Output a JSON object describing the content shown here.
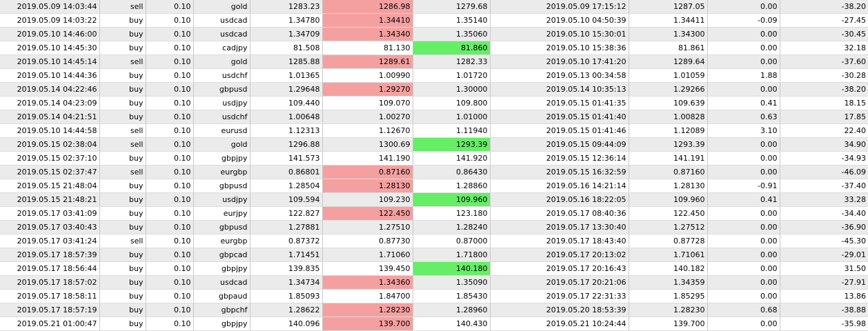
{
  "colors": {
    "row_shade": "#ebebeb",
    "row_plain": "#ffffff",
    "stop_loss_hit": "#f5a0a0",
    "take_profit_hit": "#66ee66",
    "grid_line": "#c8c8c8"
  },
  "columns": [
    "open_time",
    "type",
    "size",
    "item",
    "price",
    "stop_loss",
    "take_profit",
    "close_time",
    "close_price",
    "commission",
    "profit"
  ],
  "rows": [
    {
      "open_time": "2019.05.09 14:03:44",
      "type": "sell",
      "size": "0.10",
      "item": "gold",
      "price": "1283.23",
      "stop_loss": "1286.98",
      "take_profit": "1279.68",
      "close_time": "2019.05.09 17:15:12",
      "close_price": "1287.05",
      "commission": "0.00",
      "profit": "-38.20",
      "hit": "sl"
    },
    {
      "open_time": "2019.05.09 14:03:22",
      "type": "buy",
      "size": "0.10",
      "item": "usdcad",
      "price": "1.34780",
      "stop_loss": "1.34410",
      "take_profit": "1.35140",
      "close_time": "2019.05.10 04:50:39",
      "close_price": "1.34411",
      "commission": "-0.09",
      "profit": "-27.45",
      "hit": "sl"
    },
    {
      "open_time": "2019.05.10 14:46:00",
      "type": "buy",
      "size": "0.10",
      "item": "usdcad",
      "price": "1.34709",
      "stop_loss": "1.34340",
      "take_profit": "1.35060",
      "close_time": "2019.05.10 15:30:01",
      "close_price": "1.34300",
      "commission": "0.00",
      "profit": "-30.45",
      "hit": "sl"
    },
    {
      "open_time": "2019.05.10 14:45:30",
      "type": "buy",
      "size": "0.10",
      "item": "cadjpy",
      "price": "81.508",
      "stop_loss": "81.130",
      "take_profit": "81.860",
      "close_time": "2019.05.10 15:38:36",
      "close_price": "81.861",
      "commission": "0.00",
      "profit": "32.18",
      "hit": "tp"
    },
    {
      "open_time": "2019.05.10 14:45:14",
      "type": "sell",
      "size": "0.10",
      "item": "gold",
      "price": "1285.88",
      "stop_loss": "1289.61",
      "take_profit": "1282.33",
      "close_time": "2019.05.10 17:41:20",
      "close_price": "1289.64",
      "commission": "0.00",
      "profit": "-37.60",
      "hit": "sl"
    },
    {
      "open_time": "2019.05.10 14:44:36",
      "type": "buy",
      "size": "0.10",
      "item": "usdchf",
      "price": "1.01365",
      "stop_loss": "1.00990",
      "take_profit": "1.01720",
      "close_time": "2019.05.13 00:34:58",
      "close_price": "1.01059",
      "commission": "1.88",
      "profit": "-30.28",
      "hit": ""
    },
    {
      "open_time": "2019.05.14 04:22:46",
      "type": "buy",
      "size": "0.10",
      "item": "gbpusd",
      "price": "1.29648",
      "stop_loss": "1.29270",
      "take_profit": "1.30000",
      "close_time": "2019.05.14 10:35:13",
      "close_price": "1.29266",
      "commission": "0.00",
      "profit": "-38.20",
      "hit": "sl"
    },
    {
      "open_time": "2019.05.14 04:23:09",
      "type": "buy",
      "size": "0.10",
      "item": "usdjpy",
      "price": "109.440",
      "stop_loss": "109.070",
      "take_profit": "109.800",
      "close_time": "2019.05.15 01:41:35",
      "close_price": "109.639",
      "commission": "0.41",
      "profit": "18.15",
      "hit": ""
    },
    {
      "open_time": "2019.05.14 04:21:51",
      "type": "buy",
      "size": "0.10",
      "item": "usdchf",
      "price": "1.00648",
      "stop_loss": "1.00270",
      "take_profit": "1.01000",
      "close_time": "2019.05.15 01:41:40",
      "close_price": "1.00828",
      "commission": "0.63",
      "profit": "17.85",
      "hit": ""
    },
    {
      "open_time": "2019.05.10 14:44:58",
      "type": "sell",
      "size": "0.10",
      "item": "eurusd",
      "price": "1.12313",
      "stop_loss": "1.12670",
      "take_profit": "1.11940",
      "close_time": "2019.05.15 01:41:46",
      "close_price": "1.12089",
      "commission": "3.10",
      "profit": "22.40",
      "hit": ""
    },
    {
      "open_time": "2019.05.15 02:38:04",
      "type": "sell",
      "size": "0.10",
      "item": "gold",
      "price": "1296.88",
      "stop_loss": "1300.69",
      "take_profit": "1293.39",
      "close_time": "2019.05.15 09:44:09",
      "close_price": "1293.39",
      "commission": "0.00",
      "profit": "34.90",
      "hit": "tp"
    },
    {
      "open_time": "2019.05.15 02:37:10",
      "type": "buy",
      "size": "0.10",
      "item": "gbpjpy",
      "price": "141.573",
      "stop_loss": "141.190",
      "take_profit": "141.920",
      "close_time": "2019.05.15 12:36:14",
      "close_price": "141.191",
      "commission": "0.00",
      "profit": "-34.93",
      "hit": ""
    },
    {
      "open_time": "2019.05.15 02:37:47",
      "type": "sell",
      "size": "0.10",
      "item": "eurgbp",
      "price": "0.86801",
      "stop_loss": "0.87160",
      "take_profit": "0.86430",
      "close_time": "2019.05.15 16:32:59",
      "close_price": "0.87160",
      "commission": "0.00",
      "profit": "-46.09",
      "hit": "sl"
    },
    {
      "open_time": "2019.05.15 21:48:04",
      "type": "buy",
      "size": "0.10",
      "item": "gbpusd",
      "price": "1.28504",
      "stop_loss": "1.28130",
      "take_profit": "1.28860",
      "close_time": "2019.05.16 14:21:14",
      "close_price": "1.28130",
      "commission": "-0.91",
      "profit": "-37.40",
      "hit": "sl"
    },
    {
      "open_time": "2019.05.15 21:48:21",
      "type": "buy",
      "size": "0.10",
      "item": "usdjpy",
      "price": "109.594",
      "stop_loss": "109.230",
      "take_profit": "109.960",
      "close_time": "2019.05.16 18:22:05",
      "close_price": "109.960",
      "commission": "0.41",
      "profit": "33.28",
      "hit": "tp"
    },
    {
      "open_time": "2019.05.17 03:41:09",
      "type": "buy",
      "size": "0.10",
      "item": "eurjpy",
      "price": "122.827",
      "stop_loss": "122.450",
      "take_profit": "123.180",
      "close_time": "2019.05.17 08:40:36",
      "close_price": "122.450",
      "commission": "0.00",
      "profit": "-34.40",
      "hit": "sl"
    },
    {
      "open_time": "2019.05.17 03:40:43",
      "type": "buy",
      "size": "0.10",
      "item": "gbpusd",
      "price": "1.27881",
      "stop_loss": "1.27510",
      "take_profit": "1.28240",
      "close_time": "2019.05.17 13:30:40",
      "close_price": "1.27512",
      "commission": "0.00",
      "profit": "-36.90",
      "hit": ""
    },
    {
      "open_time": "2019.05.17 03:41:24",
      "type": "sell",
      "size": "0.10",
      "item": "eurgbp",
      "price": "0.87372",
      "stop_loss": "0.87730",
      "take_profit": "0.87000",
      "close_time": "2019.05.17 18:43:40",
      "close_price": "0.87728",
      "commission": "0.00",
      "profit": "-45.30",
      "hit": ""
    },
    {
      "open_time": "2019.05.17 18:57:39",
      "type": "buy",
      "size": "0.10",
      "item": "gbpcad",
      "price": "1.71451",
      "stop_loss": "1.71060",
      "take_profit": "1.71800",
      "close_time": "2019.05.17 20:13:02",
      "close_price": "1.71061",
      "commission": "0.00",
      "profit": "-29.01",
      "hit": ""
    },
    {
      "open_time": "2019.05.17 18:56:44",
      "type": "buy",
      "size": "0.10",
      "item": "gbpjpy",
      "price": "139.835",
      "stop_loss": "139.450",
      "take_profit": "140.180",
      "close_time": "2019.05.17 20:16:43",
      "close_price": "140.182",
      "commission": "0.00",
      "profit": "31.50",
      "hit": "tp"
    },
    {
      "open_time": "2019.05.17 18:57:02",
      "type": "buy",
      "size": "0.10",
      "item": "usdcad",
      "price": "1.34734",
      "stop_loss": "1.34360",
      "take_profit": "1.35090",
      "close_time": "2019.05.17 20:21:06",
      "close_price": "1.34359",
      "commission": "0.00",
      "profit": "-27.91",
      "hit": "sl"
    },
    {
      "open_time": "2019.05.17 18:58:11",
      "type": "buy",
      "size": "0.10",
      "item": "gbpaud",
      "price": "1.85093",
      "stop_loss": "1.84700",
      "take_profit": "1.85430",
      "close_time": "2019.05.17 22:31:33",
      "close_price": "1.85295",
      "commission": "0.00",
      "profit": "13.86",
      "hit": ""
    },
    {
      "open_time": "2019.05.17 18:57:19",
      "type": "buy",
      "size": "0.10",
      "item": "gbpchf",
      "price": "1.28622",
      "stop_loss": "1.28230",
      "take_profit": "1.28960",
      "close_time": "2019.05.20 18:53:39",
      "close_price": "1.28230",
      "commission": "0.68",
      "profit": "-38.88",
      "hit": "sl"
    },
    {
      "open_time": "2019.05.21 01:00:47",
      "type": "buy",
      "size": "0.10",
      "item": "gbpjpy",
      "price": "140.096",
      "stop_loss": "139.700",
      "take_profit": "140.430",
      "close_time": "2019.05.21 10:24:44",
      "close_price": "139.700",
      "commission": "0.00",
      "profit": "-35.98",
      "hit": "sl"
    }
  ]
}
